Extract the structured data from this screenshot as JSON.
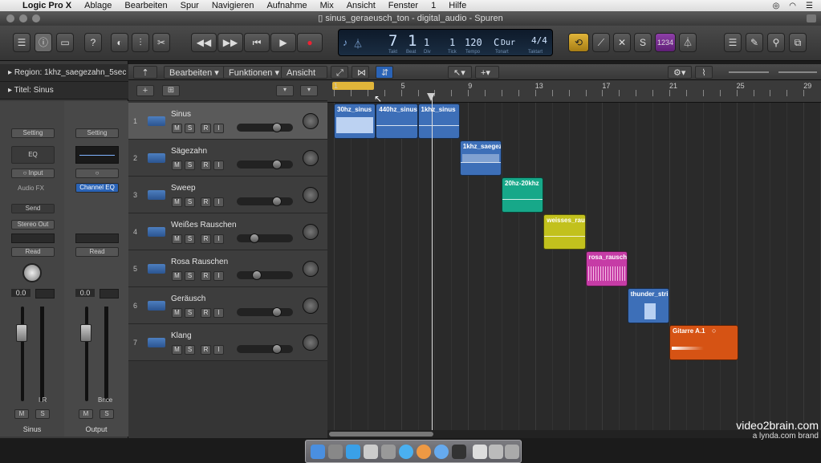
{
  "menubar": {
    "apple_icon": "apple-icon",
    "items": [
      "Logic Pro X",
      "Ablage",
      "Bearbeiten",
      "Spur",
      "Navigieren",
      "Aufnahme",
      "Mix",
      "Ansicht",
      "Fenster",
      "1",
      "Hilfe"
    ]
  },
  "window": {
    "title": "sinus_geraeusch_ton - digital_audio - Spuren"
  },
  "lcd": {
    "bar": "7",
    "beat": "1",
    "div": "1",
    "tick": "1",
    "bar_label": "Takt",
    "beat_label": "Beat",
    "div_label": "Div",
    "tick_label": "Tick",
    "tempo": "120",
    "tempo_label": "Tempo",
    "key": "C",
    "mode": "Dur",
    "key_label": "Tonart",
    "sig": "4/4",
    "sig_label": "Taktart"
  },
  "toolbar": {
    "count_in": "1234"
  },
  "inspector": {
    "region_label": "Region: 1khz_saegezahn_5sec",
    "title_label": "Titel: Sinus",
    "strip1": {
      "setting": "Setting",
      "eq": "EQ",
      "input": "Input",
      "audio_fx": "Audio FX",
      "send": "Send",
      "output": "Stereo Out",
      "automation": "Read",
      "pan_value": "0.0",
      "ir": "I  R",
      "mute": "M",
      "solo": "S",
      "name": "Sinus"
    },
    "strip2": {
      "setting": "Setting",
      "channel_eq": "Channel EQ",
      "automation": "Read",
      "pan_value": "0.0",
      "bounce": "Bnce",
      "mute": "M",
      "solo": "S",
      "name": "Output"
    }
  },
  "tracks_header": {
    "edit": "Bearbeiten",
    "functions": "Funktionen",
    "view": "Ansicht"
  },
  "tracks": [
    {
      "num": "1",
      "name": "Sinus",
      "volume": 0.75
    },
    {
      "num": "2",
      "name": "Sägezahn",
      "volume": 0.75
    },
    {
      "num": "3",
      "name": "Sweep",
      "volume": 0.75
    },
    {
      "num": "4",
      "name": "Weißes Rauschen",
      "volume": 0.28
    },
    {
      "num": "5",
      "name": "Rosa Rauschen",
      "volume": 0.32
    },
    {
      "num": "6",
      "name": "Geräusch",
      "volume": 0.75
    },
    {
      "num": "7",
      "name": "Klang",
      "volume": 0.75
    }
  ],
  "track_buttons": {
    "mute": "M",
    "solo": "S",
    "record": "R",
    "input": "I"
  },
  "ruler": {
    "labels": [
      "1",
      "5",
      "9",
      "13",
      "17",
      "21",
      "25",
      "29"
    ]
  },
  "regions": [
    {
      "name": "30hz_sinus",
      "color": "#3d6fb8",
      "track": 0
    },
    {
      "name": "440hz_sinus",
      "color": "#3d6fb8",
      "track": 0
    },
    {
      "name": "1khz_sinus",
      "color": "#3d6fb8",
      "track": 0
    },
    {
      "name": "1khz_saegez",
      "color": "#3d6fb8",
      "track": 1
    },
    {
      "name": "20hz-20khz",
      "color": "#17a889",
      "track": 2
    },
    {
      "name": "weisses_rau",
      "color": "#c2c11d",
      "track": 3
    },
    {
      "name": "rosa_rausch",
      "color": "#c63ca6",
      "track": 4
    },
    {
      "name": "thunder_stri",
      "color": "#3d6fb8",
      "track": 5
    },
    {
      "name": "Gitarre A.1",
      "color": "#d65314",
      "track": 6
    }
  ],
  "watermark": {
    "brand": "video2brain.com",
    "sub": "a lynda.com brand"
  }
}
